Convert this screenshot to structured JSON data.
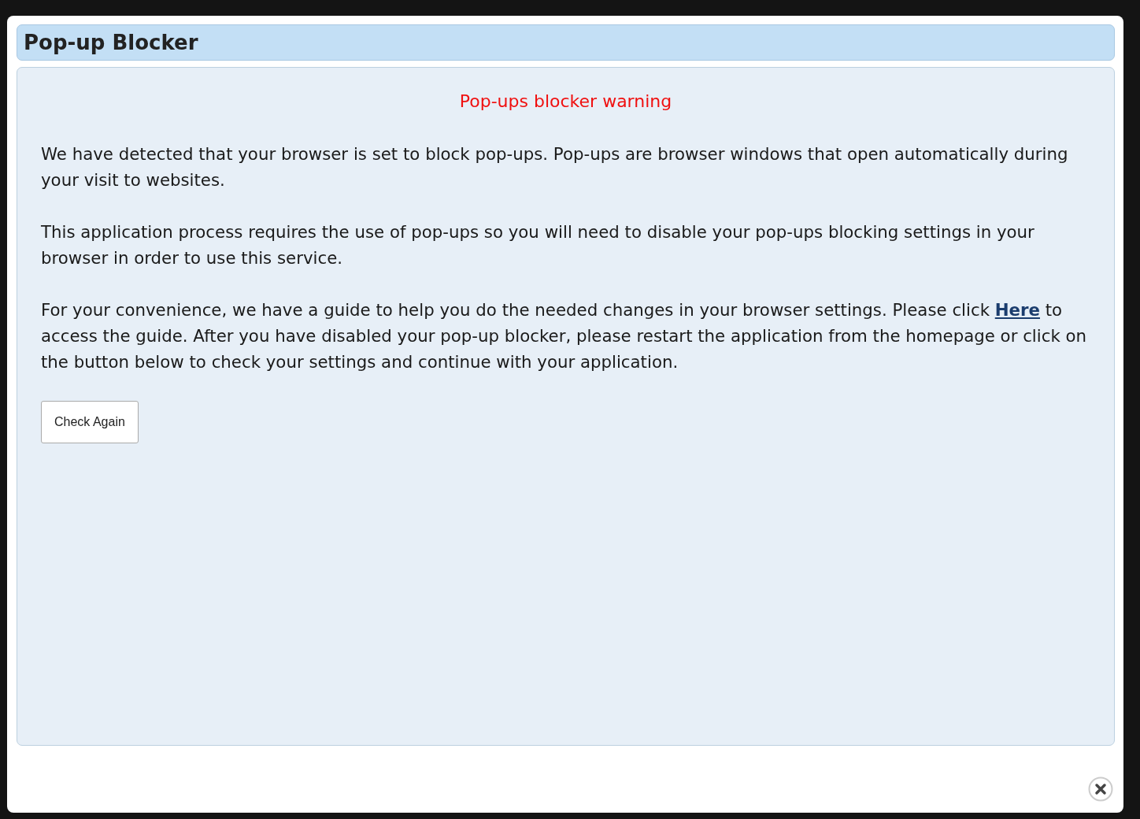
{
  "dialog": {
    "title": "Pop-up Blocker",
    "heading": "Pop-ups blocker warning",
    "paragraphs": [
      {
        "kind": "plain",
        "text": "We have detected that your browser is set to block pop-ups. Pop-ups are browser windows that open automatically during your visit to websites."
      },
      {
        "kind": "plain",
        "text": "This application process requires the use of pop-ups so you will need to disable your pop-ups blocking settings in your browser in order to use this service."
      },
      {
        "kind": "link",
        "before": "For your convenience, we have a guide to help you do the needed changes in your browser settings. Please click",
        "link": "Here",
        "after": "to access the guide. After you have disabled your pop-up blocker, please restart the application from the homepage or click on the button below to check your settings and continue with your application."
      }
    ],
    "button": "Check Again"
  }
}
